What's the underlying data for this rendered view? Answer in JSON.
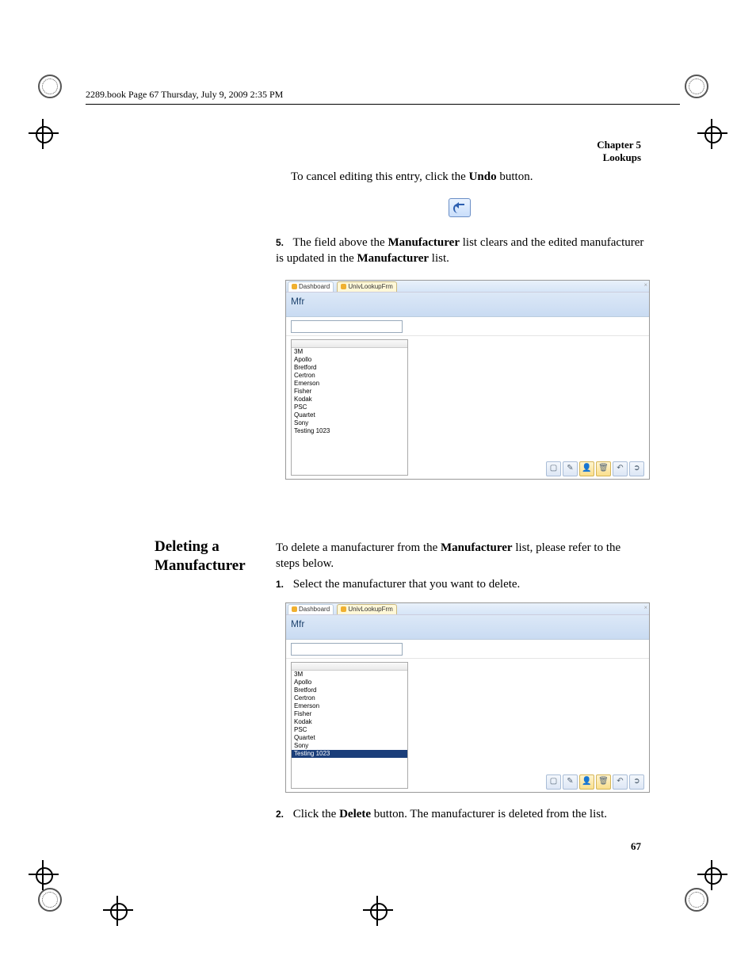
{
  "header": {
    "runhead": "2289.book  Page 67  Thursday, July 9, 2009  2:35 PM"
  },
  "chapter": {
    "line1": "Chapter 5",
    "line2": "Lookups"
  },
  "intro_before": "To cancel editing this entry, click the ",
  "intro_bold": "Undo",
  "intro_after": " button.",
  "step5_num": "5.",
  "step5_a": "The field above the ",
  "step5_b": "Manufacturer",
  "step5_c": " list clears and the edited manufac­turer is updated in the ",
  "step5_d": "Manufacturer",
  "step5_e": " list.",
  "sidehead": {
    "l1": "Deleting a",
    "l2": "Manufacturer"
  },
  "del_intro_a": "To delete a manufacturer from the ",
  "del_intro_b": "Manufacturer",
  "del_intro_c": " list, please refer to the steps below.",
  "step1_num": "1.",
  "step1_text": "Select the manufacturer that you want to delete.",
  "step2_num": "2.",
  "step2_a": "Click the ",
  "step2_b": "Delete",
  "step2_c": " button. The manufacturer is deleted from the list.",
  "page_number": "67",
  "shot": {
    "tab1": "Dashboard",
    "tab2": "UnivLookupFrm",
    "title": "Mfr",
    "items1": [
      "3M",
      "Apollo",
      "Bretford",
      "Certron",
      "Emerson",
      "Fisher",
      "Kodak",
      "PSC",
      "Quartet",
      "Sony",
      "Testing 1023"
    ],
    "items2": [
      "3M",
      "Apollo",
      "Bretford",
      "Certron",
      "Emerson",
      "Fisher",
      "Kodak",
      "PSC",
      "Quartet",
      "Sony",
      "Testing 1023"
    ],
    "selected2": "Testing 1023"
  }
}
